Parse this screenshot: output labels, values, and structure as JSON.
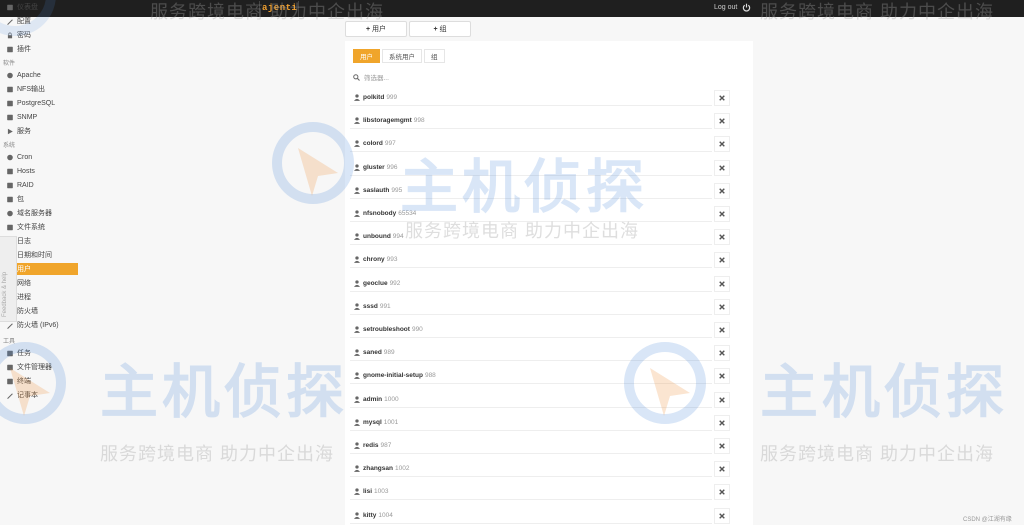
{
  "header": {
    "logo": "ajenti",
    "logout_label": "Log out"
  },
  "sidebar": {
    "top_items": [
      {
        "label": "仪表盘",
        "icon": "dashboard-icon"
      },
      {
        "label": "配置",
        "icon": "wrench-icon"
      },
      {
        "label": "密码",
        "icon": "lock-icon"
      },
      {
        "label": "插件",
        "icon": "cogs-icon"
      }
    ],
    "cat_software": "软件",
    "software_items": [
      {
        "label": "Apache",
        "icon": "globe-icon"
      },
      {
        "label": "NFS输出",
        "icon": "hdd-icon"
      },
      {
        "label": "PostgreSQL",
        "icon": "database-icon"
      },
      {
        "label": "SNMP",
        "icon": "exchange-icon"
      },
      {
        "label": "服务",
        "icon": "play-icon"
      }
    ],
    "cat_system": "系统",
    "system_items": [
      {
        "label": "Cron",
        "icon": "clock-icon"
      },
      {
        "label": "Hosts",
        "icon": "sitemap-icon"
      },
      {
        "label": "RAID",
        "icon": "hdd-icon"
      },
      {
        "label": "包",
        "icon": "gift-icon"
      },
      {
        "label": "域名服务器",
        "icon": "globe-icon"
      },
      {
        "label": "文件系统",
        "icon": "hdd-icon"
      },
      {
        "label": "日志",
        "icon": "list-icon"
      },
      {
        "label": "日期和时间",
        "icon": "clock-icon"
      },
      {
        "label": "用户",
        "icon": "group-icon"
      },
      {
        "label": "网络",
        "icon": "globe-icon"
      },
      {
        "label": "进程",
        "icon": "list-icon"
      },
      {
        "label": "防火墙",
        "icon": "fire-icon"
      },
      {
        "label": "防火墙 (IPv6)",
        "icon": "fire-icon"
      }
    ],
    "cat_tools": "工具",
    "tools_items": [
      {
        "label": "任务",
        "icon": "cog-icon"
      },
      {
        "label": "文件管理器",
        "icon": "folder-icon"
      },
      {
        "label": "终端",
        "icon": "terminal-icon"
      },
      {
        "label": "记事本",
        "icon": "edit-icon"
      }
    ]
  },
  "actions": {
    "add_user": "用户",
    "add_group": "组"
  },
  "tabs": [
    {
      "label": "用户",
      "active": true
    },
    {
      "label": "系统用户",
      "active": false
    },
    {
      "label": "组",
      "active": false
    }
  ],
  "filter": {
    "placeholder": "筛选器..."
  },
  "users": [
    {
      "name": "polkitd",
      "uid": "999"
    },
    {
      "name": "libstoragemgmt",
      "uid": "998"
    },
    {
      "name": "colord",
      "uid": "997"
    },
    {
      "name": "gluster",
      "uid": "996"
    },
    {
      "name": "saslauth",
      "uid": "995"
    },
    {
      "name": "nfsnobody",
      "uid": "65534"
    },
    {
      "name": "unbound",
      "uid": "994"
    },
    {
      "name": "chrony",
      "uid": "993"
    },
    {
      "name": "geoclue",
      "uid": "992"
    },
    {
      "name": "sssd",
      "uid": "991"
    },
    {
      "name": "setroubleshoot",
      "uid": "990"
    },
    {
      "name": "saned",
      "uid": "989"
    },
    {
      "name": "gnome-initial-setup",
      "uid": "988"
    },
    {
      "name": "admin",
      "uid": "1000"
    },
    {
      "name": "mysql",
      "uid": "1001"
    },
    {
      "name": "redis",
      "uid": "987"
    },
    {
      "name": "zhangsan",
      "uid": "1002"
    },
    {
      "name": "lisi",
      "uid": "1003"
    },
    {
      "name": "kitty",
      "uid": "1004"
    }
  ],
  "feedback": "Feedback & help",
  "watermark": {
    "slogan": "服务跨境电商  助力中企出海",
    "brand": "主机侦探"
  },
  "credit": "CSDN @江湖有缘",
  "colors": {
    "accent": "#f0a52b",
    "topbar": "#1f1f1f"
  }
}
